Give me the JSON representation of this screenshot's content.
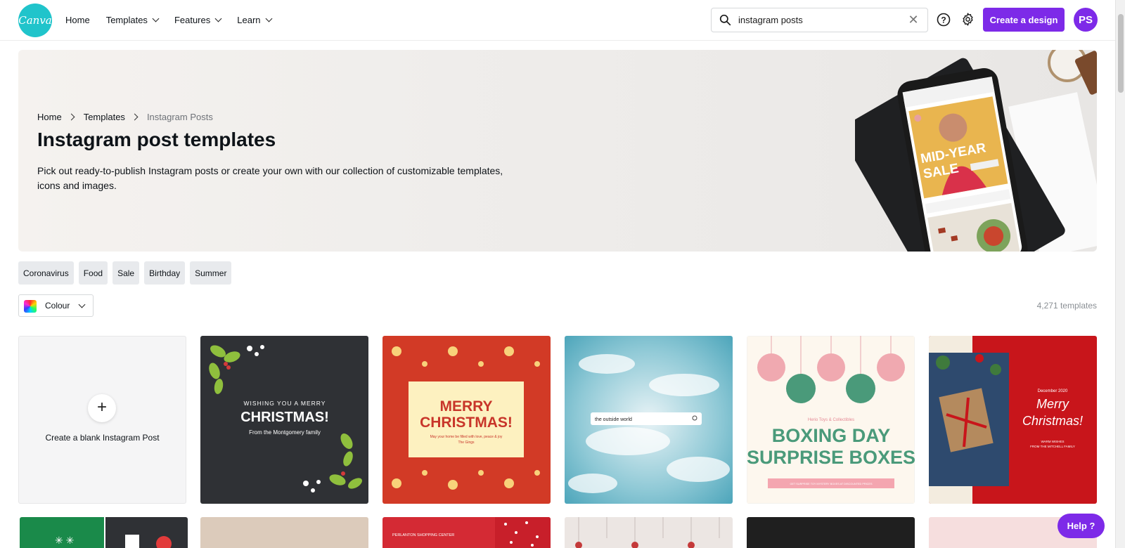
{
  "topbar": {
    "logo_text": "Canva",
    "nav": [
      {
        "label": "Home",
        "dropdown": false
      },
      {
        "label": "Templates",
        "dropdown": true
      },
      {
        "label": "Features",
        "dropdown": true
      },
      {
        "label": "Learn",
        "dropdown": true
      }
    ],
    "search_value": "instagram posts",
    "create_button": "Create a design",
    "avatar_initials": "PS"
  },
  "hero": {
    "breadcrumb": [
      "Home",
      "Templates",
      "Instagram Posts"
    ],
    "title": "Instagram post templates",
    "description": "Pick out ready-to-publish Instagram posts or create your own with our collection of customizable templates, icons and images.",
    "phone_text": {
      "line1": "MID-YEAR",
      "line2": "SALE"
    }
  },
  "chips": [
    "Coronavirus",
    "Food",
    "Sale",
    "Birthday",
    "Summer"
  ],
  "filter": {
    "colour_label": "Colour"
  },
  "template_count": "4,271 templates",
  "blank_card": {
    "label": "Create a blank Instagram Post"
  },
  "templates": [
    {
      "name": "christmas-dark",
      "line1": "WISHING YOU A MERRY",
      "line2": "CHRISTMAS!",
      "line3": "From the Montgomery family"
    },
    {
      "name": "christmas-red",
      "line1": "MERRY",
      "line2": "CHRISTMAS!",
      "line3": "May your home be filled with love, peace & joy",
      "line4": "The Gings"
    },
    {
      "name": "outside-world",
      "line1": "the outside world"
    },
    {
      "name": "boxing-day",
      "line1": "Herio Toys & Collectibles",
      "line2": "BOXING DAY",
      "line3": "SURPRISE BOXES",
      "line4": "GET SURPRISE TOY MYSTERY BOXES AT DISCOUNTED PRICES"
    },
    {
      "name": "merry-christmas-photo",
      "line1": "December 2020",
      "line2": "Merry",
      "line3": "Christmas!",
      "line4": "WARM WISHES",
      "line5": "FROM THE MITCHELL FAMILY"
    }
  ],
  "row2": {
    "mall_text": "PERLANTON SHOPPING CENTER"
  },
  "help_button": "Help ?",
  "colors": {
    "brand": "#7d2ae8",
    "logo": "#20c4cb"
  }
}
